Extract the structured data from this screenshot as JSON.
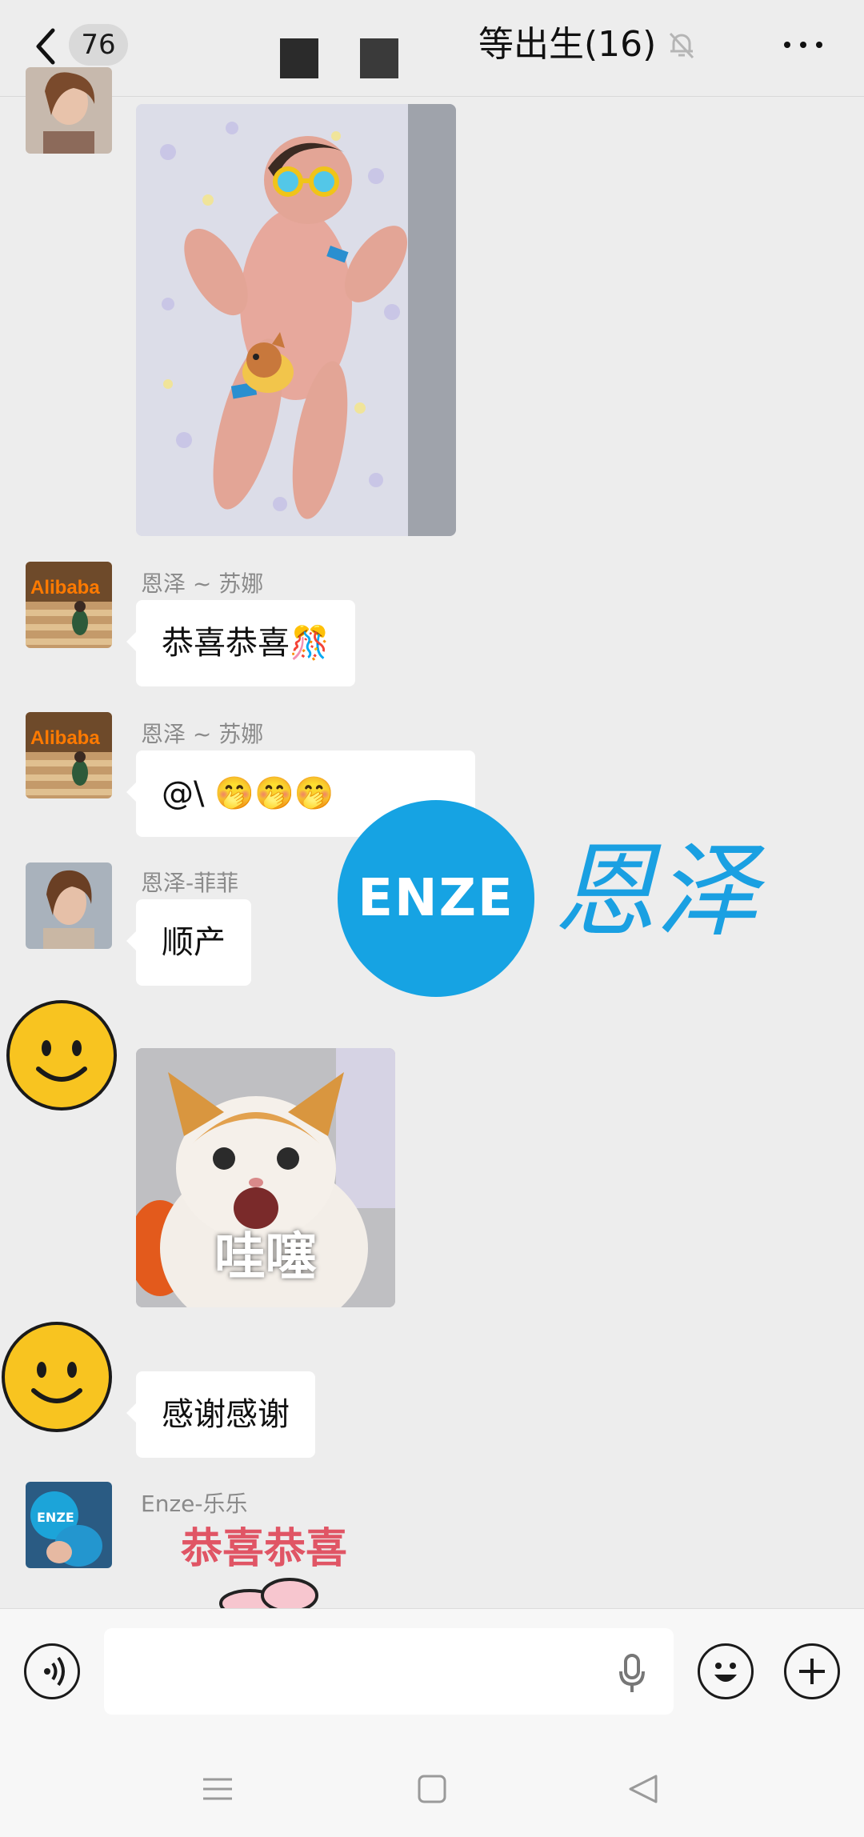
{
  "header": {
    "back_icon": "chevron-left-icon",
    "unread_count": "76",
    "title": "等出生(16)",
    "mute_icon": "bell-off-icon",
    "more_icon": "more-icon"
  },
  "messages": [
    {
      "type": "image",
      "sender": "",
      "content": "newborn baby photo"
    },
    {
      "type": "text",
      "sender": "恩泽 ~ 苏娜",
      "text": "恭喜恭喜🎊"
    },
    {
      "type": "text",
      "sender": "恩泽 ~ 苏娜",
      "text": "@\\          🤭🤭🤭"
    },
    {
      "type": "text",
      "sender": "恩泽-菲菲",
      "text": "顺产"
    },
    {
      "type": "sticker",
      "sender": "",
      "caption": "哇噻"
    },
    {
      "type": "text",
      "sender": "",
      "text": "感谢感谢"
    },
    {
      "type": "sticker",
      "sender": "Enze-乐乐",
      "caption": "恭喜恭喜"
    }
  ],
  "avatars": {
    "alibaba_text": "Alibaba",
    "enze_text": "ENZE"
  },
  "watermark": {
    "text_en": "ENZE",
    "text_cn": "恩泽"
  },
  "input_bar": {
    "voice_icon": "voice-icon",
    "placeholder": "",
    "mic_icon": "mic-icon",
    "emoji_icon": "emoji-icon",
    "plus_icon": "plus-icon"
  },
  "nav": {
    "menu_icon": "menu-icon",
    "home_icon": "home-icon",
    "back_icon": "back-triangle-icon"
  },
  "colors": {
    "accent": "#16a3e3",
    "background": "#ededed",
    "bubble": "#ffffff"
  }
}
